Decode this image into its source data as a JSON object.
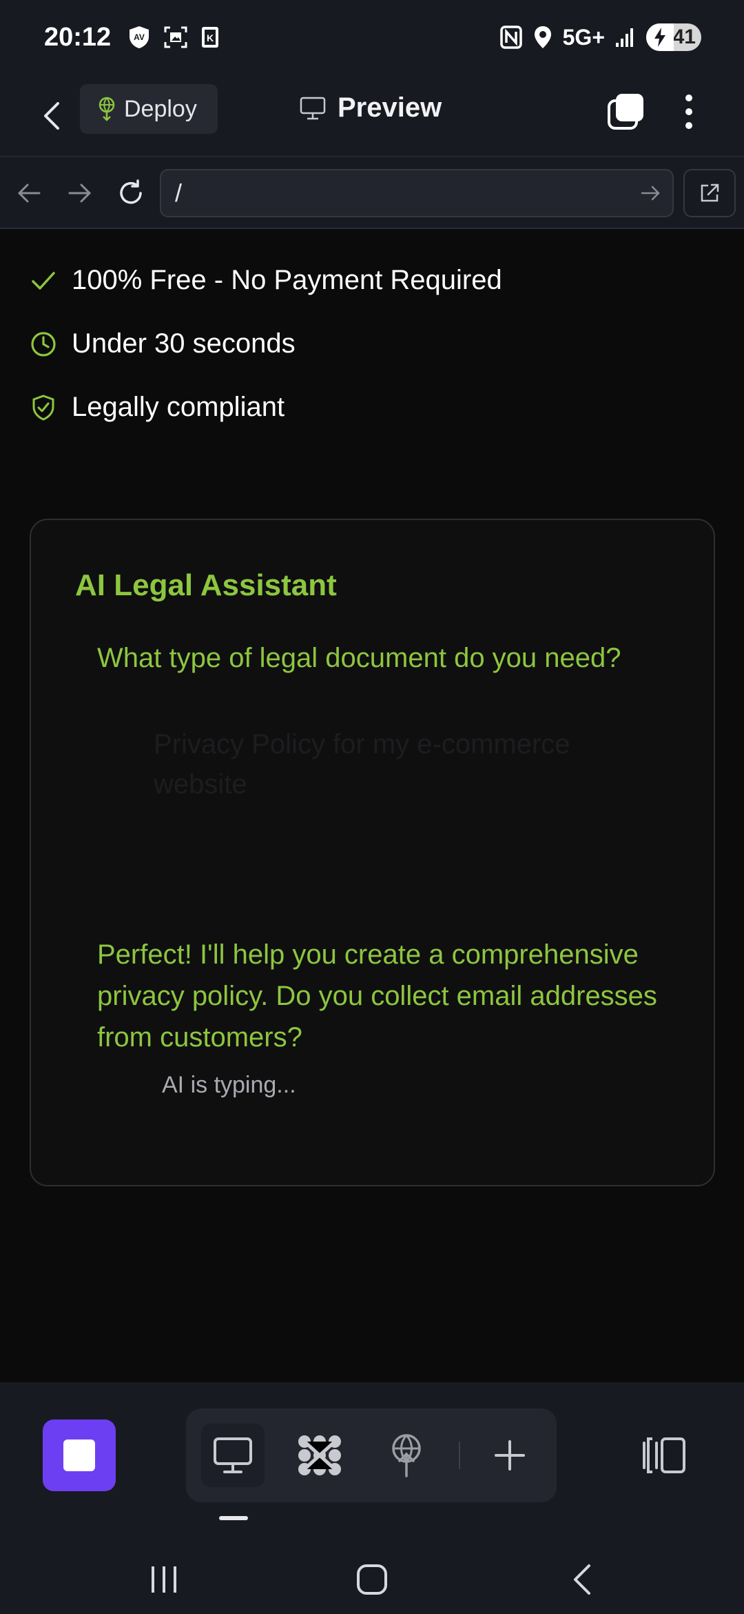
{
  "status_bar": {
    "time": "20:12",
    "network": "5G+",
    "battery": "41",
    "left_icons": [
      "av-shield-icon",
      "screenshot-icon",
      "k-box-icon"
    ],
    "right_icons": [
      "nfc-icon",
      "location-icon",
      "signal-icon",
      "battery-icon"
    ]
  },
  "header": {
    "deploy_label": "Deploy",
    "title": "Preview"
  },
  "browser": {
    "url": "/"
  },
  "features": [
    {
      "label": "100% Free - No Payment Required",
      "icon": "check-icon"
    },
    {
      "label": "Under 30 seconds",
      "icon": "clock-icon"
    },
    {
      "label": "Legally compliant",
      "icon": "shield-check-icon"
    }
  ],
  "assistant": {
    "title": "AI Legal Assistant",
    "question": "What type of legal document do you need?",
    "user_message": "Privacy Policy for my e-commerce website",
    "response": "Perfect! I'll help you create a comprehensive privacy policy. Do you collect email addresses from customers?",
    "typing": "AI is typing..."
  },
  "colors": {
    "accent_green": "#8dc63f",
    "stop_button": "#6d3ff2",
    "chrome_bg": "#181a21",
    "page_bg": "#0b0b0c"
  }
}
